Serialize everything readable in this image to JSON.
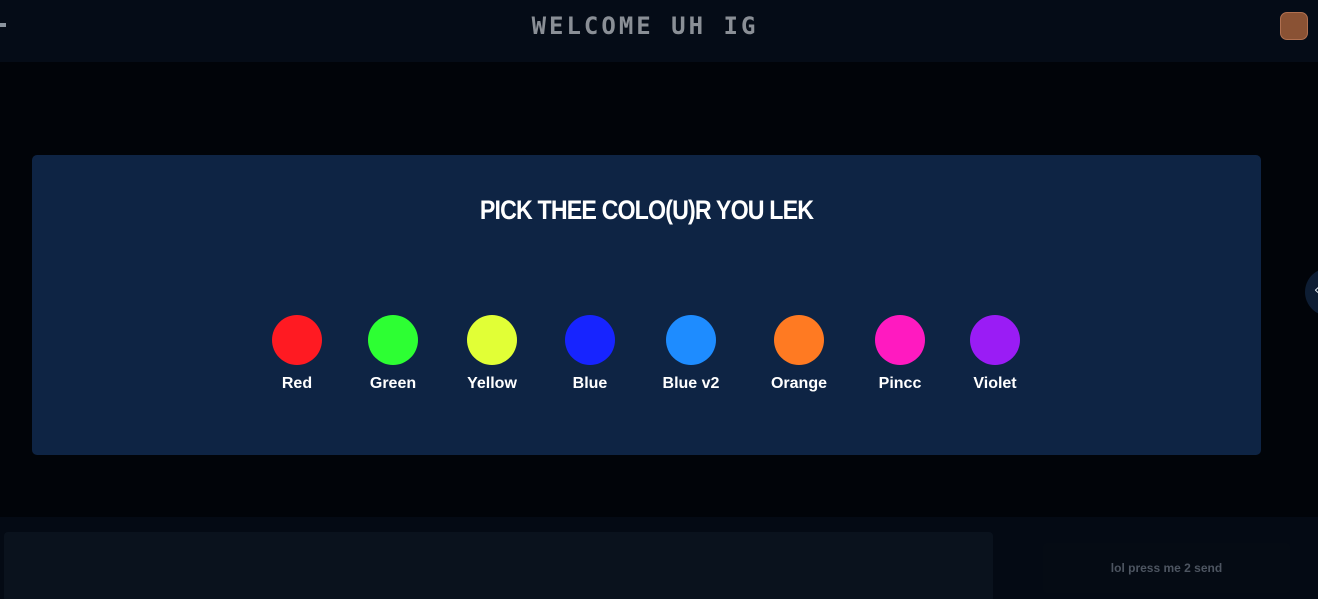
{
  "header": {
    "title": "WELCOME UH IG",
    "avatar_color": "#8a5234"
  },
  "side_handle": {
    "icon": "chevron-left-icon",
    "glyph": "‹"
  },
  "color_picker": {
    "title": "PICK THEE COLO(U)R YOU LEK",
    "colors": [
      {
        "label": "Red",
        "hex": "#ff1a22"
      },
      {
        "label": "Green",
        "hex": "#2dff33"
      },
      {
        "label": "Yellow",
        "hex": "#e1ff36"
      },
      {
        "label": "Blue",
        "hex": "#1724ff"
      },
      {
        "label": "Blue v2",
        "hex": "#1e8cff"
      },
      {
        "label": "Orange",
        "hex": "#ff7a22"
      },
      {
        "label": "Pincc",
        "hex": "#ff1ac0"
      },
      {
        "label": "Violet",
        "hex": "#9a1cf5"
      }
    ]
  },
  "footer": {
    "send_label": "lol press me 2 send"
  }
}
